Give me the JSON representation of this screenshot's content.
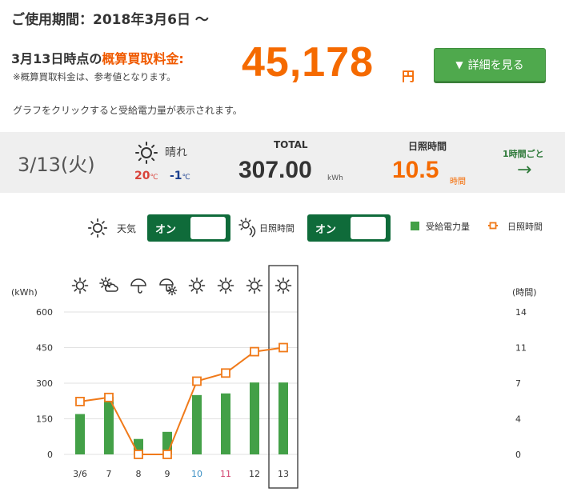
{
  "header": {
    "period_label": "ご使用期間：2018年3月6日 ～",
    "asof_prefix": "3月13日時点の",
    "asof_highlight": "概算買取料金:",
    "note": "※概算買取料金は、参考値となります。",
    "amount": "45,178",
    "amount_unit": "円",
    "detail_button": "詳細を見る",
    "hint": "グラフをクリックすると受給電力量が表示されます。"
  },
  "summary": {
    "date": "3/13(火)",
    "weather": "晴れ",
    "weather_icon": "sun-icon",
    "temp_high": "20",
    "temp_low": "-1",
    "temp_unit": "℃",
    "total_label": "TOTAL",
    "total_value": "307.00",
    "total_unit": "kWh",
    "sunshine_label": "日照時間",
    "sunshine_value": "10.5",
    "sunshine_unit": "時間",
    "hourly_label": "1時間ごと",
    "hourly_icon": "arrow-right-icon"
  },
  "controls": {
    "weather_label": "天気",
    "weather_toggle": "オン",
    "sunshine_label": "日照時間",
    "sunshine_toggle": "オン"
  },
  "legend": {
    "bar_label": "受給電力量",
    "line_label": "日照時間"
  },
  "colors": {
    "bar": "#43a047",
    "line": "#f07a1a",
    "amount": "#f56a00",
    "toggle": "#0f6b3a",
    "button": "#4fa94d",
    "date_blue": "#3a8fc4",
    "date_red": "#d2416e"
  },
  "chart_data": {
    "type": "bar",
    "categories": [
      "3/6",
      "7",
      "8",
      "9",
      "10",
      "11",
      "12",
      "13"
    ],
    "category_colors": [
      "#333333",
      "#333333",
      "#333333",
      "#333333",
      "#3a8fc4",
      "#d2416e",
      "#333333",
      "#333333"
    ],
    "weather_icons": [
      "sun-icon",
      "sun-cloud-icon",
      "umbrella-icon",
      "umbrella-sun-icon",
      "sun-icon",
      "sun-icon",
      "sun-icon",
      "sun-icon"
    ],
    "series": [
      {
        "name": "受給電力量",
        "type": "bar",
        "axis": "left",
        "values": [
          170,
          243,
          65,
          95,
          250,
          257,
          303,
          303
        ]
      },
      {
        "name": "日照時間",
        "type": "line",
        "axis": "right",
        "values": [
          5.2,
          5.6,
          0,
          0,
          7.2,
          8.0,
          10.1,
          10.5
        ]
      }
    ],
    "ylabel_left": "(kWh)",
    "ylabel_right": "(時間)",
    "yticks_left": [
      "600",
      "450",
      "300",
      "150",
      "0"
    ],
    "yticks_right": [
      "14",
      "11",
      "7",
      "4",
      "0"
    ],
    "ylim_left": [
      0,
      600
    ],
    "ylim_right": [
      0,
      14
    ],
    "selected": "13",
    "grid": true
  }
}
